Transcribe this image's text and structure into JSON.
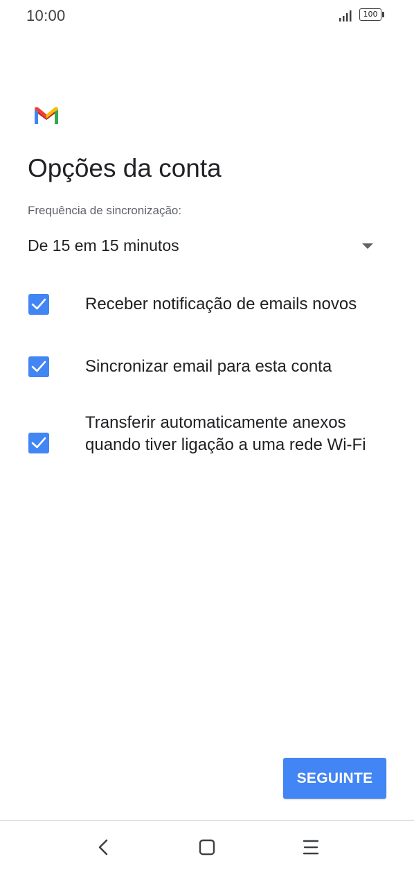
{
  "status_bar": {
    "time": "10:00",
    "battery": "100"
  },
  "page": {
    "title": "Opções da conta"
  },
  "sync": {
    "label": "Frequência de sincronização:",
    "selected_value": "De 15 em 15 minutos"
  },
  "options": [
    {
      "label": "Receber notificação de emails novos",
      "checked": true
    },
    {
      "label": "Sincronizar email para esta conta",
      "checked": true
    },
    {
      "label": "Transferir automaticamente anexos quando tiver ligação a uma rede Wi-Fi",
      "checked": true
    }
  ],
  "actions": {
    "next_label": "SEGUINTE"
  },
  "icons": {
    "app_logo": "gmail-logo-icon",
    "signal": "signal-icon",
    "battery": "battery-icon",
    "back": "back-icon",
    "home": "home-icon",
    "menu": "menu-icon"
  },
  "colors": {
    "accent": "#4285f4",
    "text_primary": "#202124",
    "text_secondary": "#5f6368"
  }
}
